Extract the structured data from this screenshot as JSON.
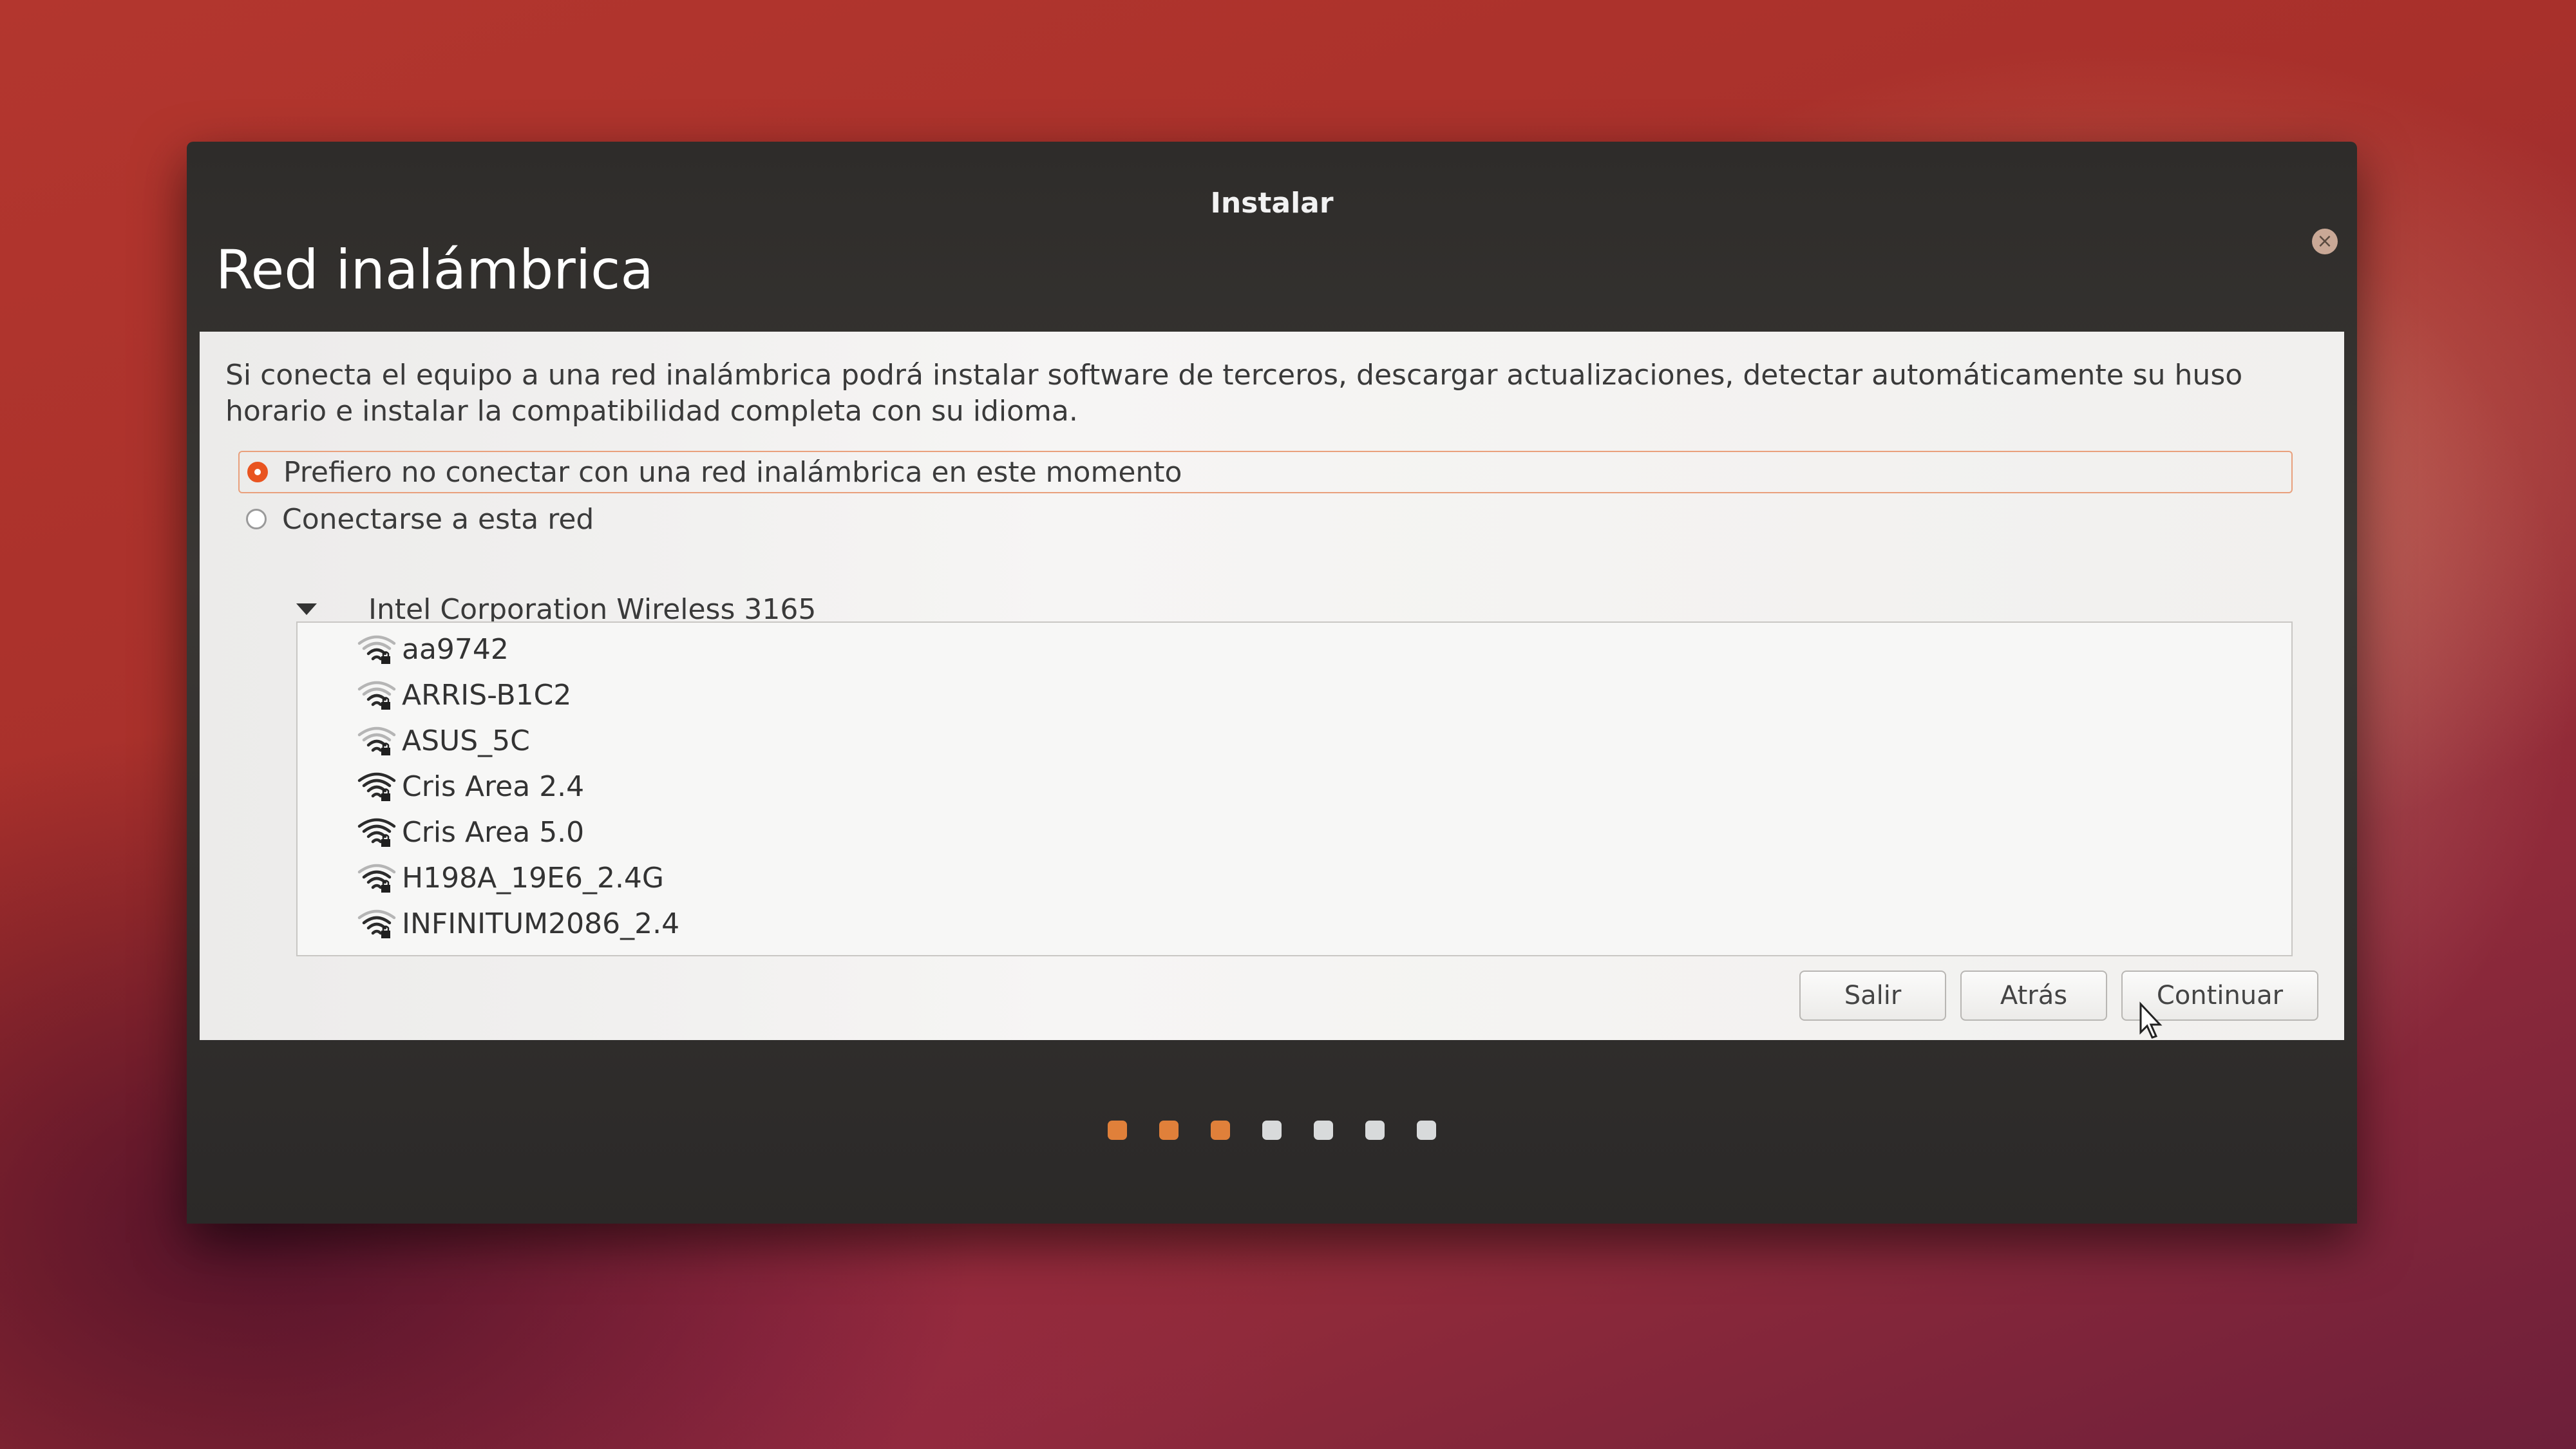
{
  "window": {
    "title": "Instalar",
    "close_icon": "close-icon"
  },
  "page": {
    "title": "Red inalámbrica",
    "description": "Si conecta el equipo a una red inalámbrica podrá instalar software de terceros, descargar actualizaciones, detectar automáticamente su huso horario e instalar la compatibilidad completa con su idioma."
  },
  "options": {
    "no_connect_label": "Prefiero no conectar con una red inalámbrica en este momento",
    "no_connect_selected": true,
    "connect_label": "Conectarse a esta red",
    "connect_selected": false
  },
  "networks": {
    "adapter": "Intel Corporation Wireless 3165",
    "items": [
      {
        "ssid": "aa9742",
        "signal": 2,
        "secured": true
      },
      {
        "ssid": "ARRIS-B1C2",
        "signal": 2,
        "secured": true
      },
      {
        "ssid": "ASUS_5C",
        "signal": 2,
        "secured": true
      },
      {
        "ssid": "Cris Area 2.4",
        "signal": 4,
        "secured": true
      },
      {
        "ssid": "Cris Area 5.0",
        "signal": 4,
        "secured": true
      },
      {
        "ssid": "H198A_19E6_2.4G",
        "signal": 3,
        "secured": true
      },
      {
        "ssid": "INFINITUM2086_2.4",
        "signal": 3,
        "secured": true
      }
    ]
  },
  "buttons": {
    "quit": "Salir",
    "back": "Atrás",
    "continue": "Continuar"
  },
  "progress": {
    "total_steps": 7,
    "completed_steps": 3
  },
  "colors": {
    "accent": "#e95420",
    "progress_done": "#e0803a",
    "progress_todo": "#d8dadb"
  }
}
